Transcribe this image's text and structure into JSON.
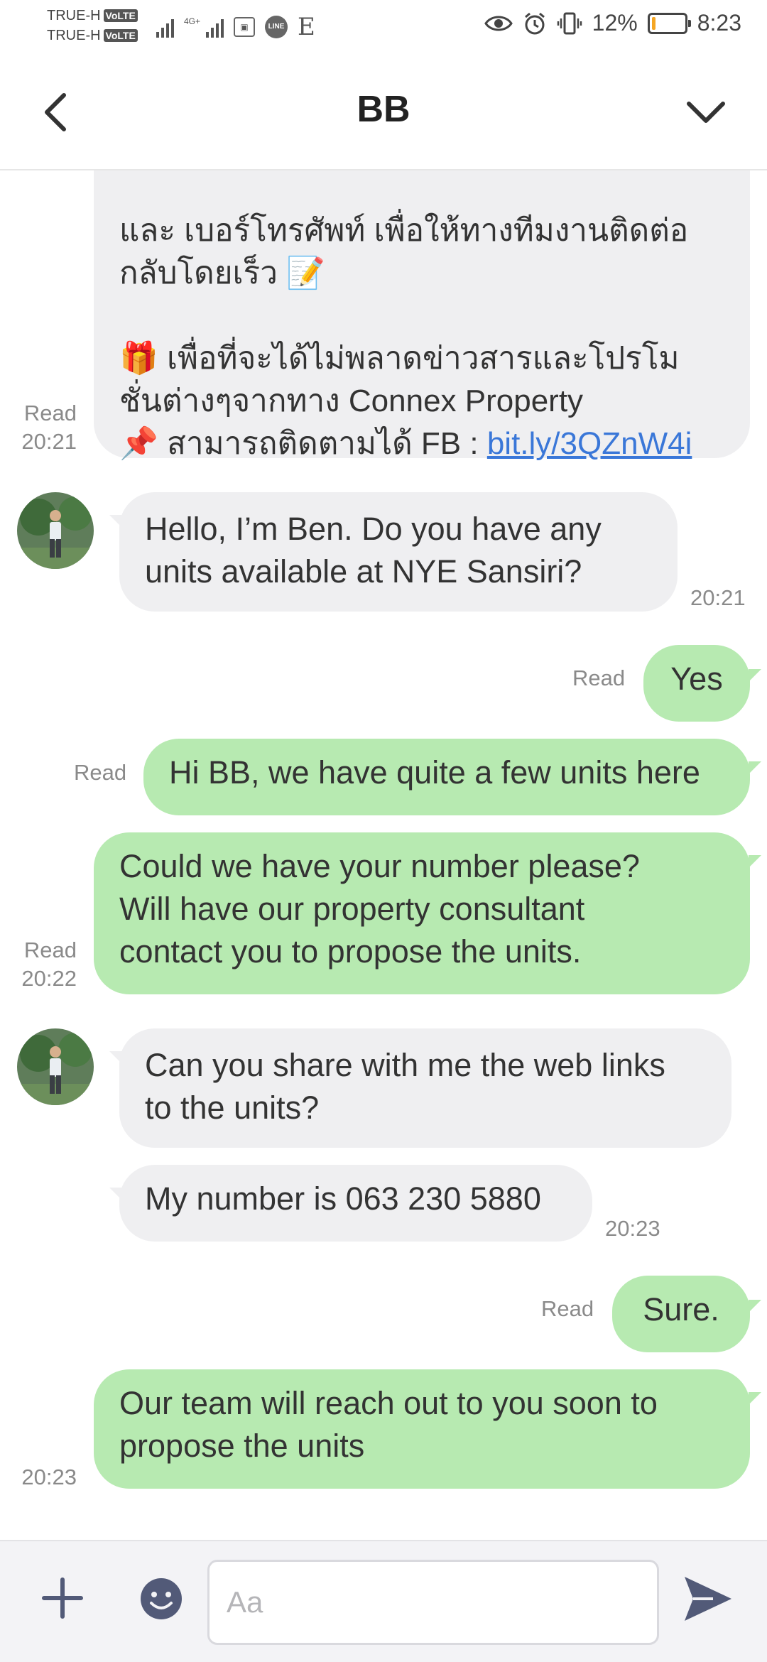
{
  "status_bar": {
    "carrier_1": "TRUE-H",
    "carrier_2": "TRUE-H",
    "volte_badge": "VoLTE",
    "network_label": "4G+",
    "battery_percent": "12%",
    "battery_level": 0.12,
    "time": "8:23",
    "icons": [
      "signal-icon",
      "signal-4g-icon",
      "app-icon",
      "line-app-icon",
      "e-app-icon",
      "eye-icon",
      "alarm-icon",
      "vibrate-icon",
      "battery-icon"
    ]
  },
  "header": {
    "title": "BB",
    "back_icon": "chevron-left-icon",
    "menu_icon": "chevron-down-icon"
  },
  "messages": {
    "m1": {
      "line_a": "และ เบอร์โทรศัพท์ เพื่อให้ทางทีมงานติดต่อ",
      "line_b": "กลับโดยเร็ว 📝",
      "line_c": "🎁 เพื่อที่จะได้ไม่พลาดข่าวสารและโปรโม",
      "line_d": "ชั่นต่างๆจากทาง Connex Property",
      "line_e": "📌 สามารถติดตามได้ FB : ",
      "link": "bit.ly/3QZnW4i",
      "read": "Read",
      "time": "20:21"
    },
    "m2": {
      "text": "Hello, I’m Ben. Do you have any\nunits available at NYE Sansiri?",
      "time": "20:21"
    },
    "m3": {
      "text": "Yes",
      "read": "Read"
    },
    "m4": {
      "text": "Hi BB, we have quite a few units here",
      "read": "Read"
    },
    "m5": {
      "text": "Could we have your number please?\nWill have our property consultant\ncontact you to propose the units.",
      "read": "Read",
      "time": "20:22"
    },
    "m6": {
      "text": "Can you share with me the web links\nto the units?"
    },
    "m7": {
      "text": "My number is 063 230 5880",
      "time": "20:23"
    },
    "m8": {
      "text": "Sure.",
      "read": "Read"
    },
    "m9": {
      "text": "Our team will reach out to you soon to\npropose the units",
      "time": "20:23"
    }
  },
  "input_bar": {
    "placeholder": "Aa",
    "plus_icon": "plus-icon",
    "emoji_icon": "emoji-icon",
    "send_icon": "send-icon"
  },
  "colors": {
    "incoming_bubble": "#efeff1",
    "outgoing_bubble": "#b7eab1",
    "link": "#3a77d8",
    "battery_low": "#f5a623"
  }
}
